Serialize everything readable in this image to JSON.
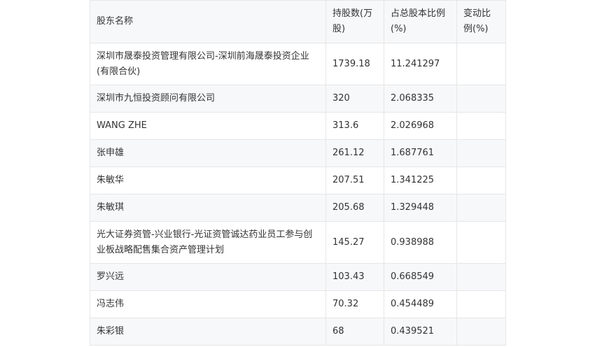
{
  "table": {
    "headers": [
      "股东名称",
      "持股数(万股)",
      "占总股本比例(%)",
      "变动比例(%)"
    ],
    "rows": [
      [
        "深圳市晟泰投资管理有限公司-深圳前海晟泰投资企业(有限合伙)",
        "1739.18",
        "11.241297",
        ""
      ],
      [
        "深圳市九恒投资顾问有限公司",
        "320",
        "2.068335",
        ""
      ],
      [
        "WANG ZHE",
        "313.6",
        "2.026968",
        ""
      ],
      [
        "张申雄",
        "261.12",
        "1.687761",
        ""
      ],
      [
        "朱敏华",
        "207.51",
        "1.341225",
        ""
      ],
      [
        "朱敏琪",
        "205.68",
        "1.329448",
        ""
      ],
      [
        "光大证券资管-兴业银行-光证资管诚达药业员工参与创业板战略配售集合资产管理计划",
        "145.27",
        "0.938988",
        ""
      ],
      [
        "罗兴远",
        "103.43",
        "0.668549",
        ""
      ],
      [
        "冯志伟",
        "70.32",
        "0.454489",
        ""
      ],
      [
        "朱彩银",
        "68",
        "0.439521",
        ""
      ]
    ]
  }
}
